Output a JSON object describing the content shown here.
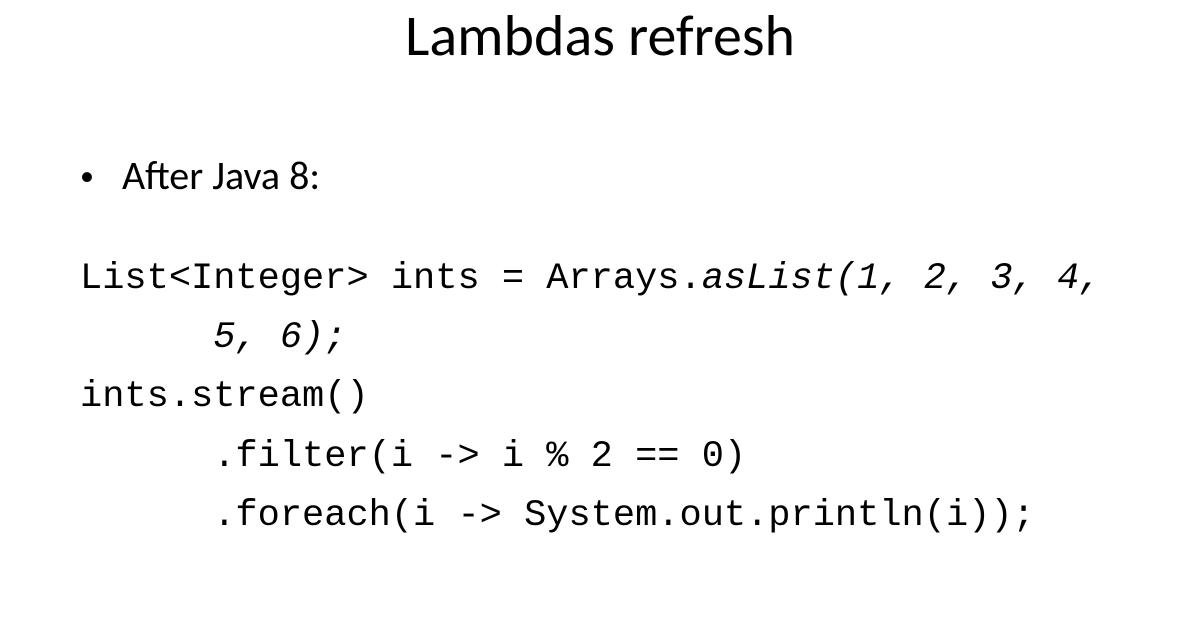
{
  "slide": {
    "title": "Lambdas refresh",
    "bullet": {
      "dot": "•",
      "text": "After Java 8:"
    },
    "code": {
      "line1a": "List<Integer> ints = Arrays.",
      "line1b_italic": "asList(1, 2, 3, 4,",
      "line2_italic": "      5, 6);",
      "line3": "ints.stream()",
      "line4": "      .filter(i -> i % 2 == 0)",
      "line5": "      .foreach(i -> System.out.println(i));"
    }
  }
}
